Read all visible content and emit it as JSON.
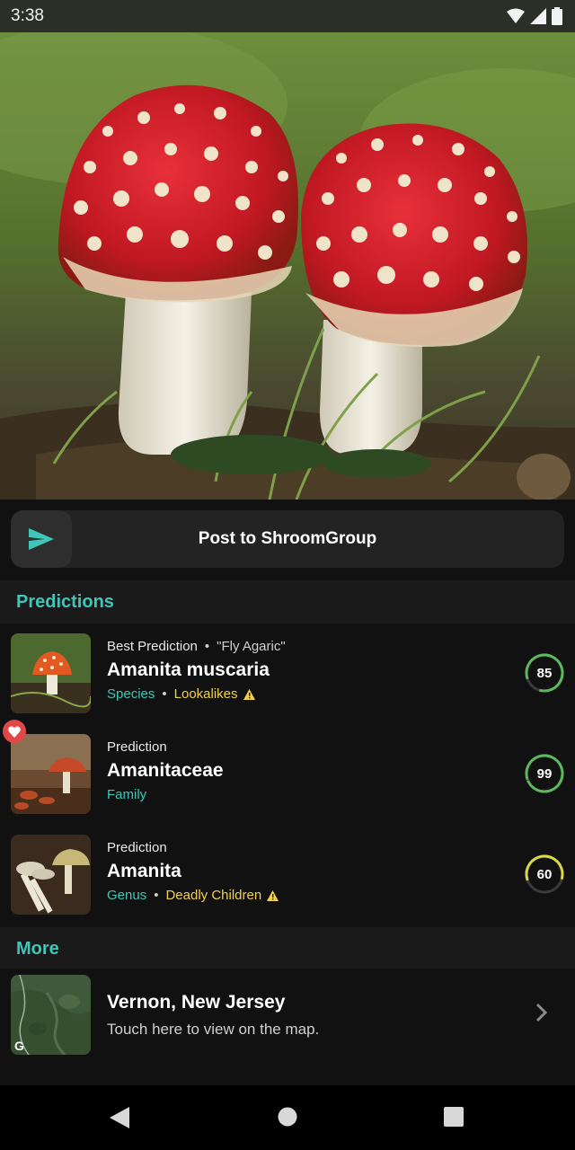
{
  "status": {
    "time": "3:38"
  },
  "post": {
    "label": "Post to ShroomGroup"
  },
  "sections": {
    "predictions": "Predictions",
    "more": "More"
  },
  "predictions": [
    {
      "kind": "Best Prediction",
      "common_name": "\"Fly Agaric\"",
      "name": "Amanita muscaria",
      "rank": "Species",
      "warning": "Lookalikes",
      "score": "85",
      "score_value": 0.85,
      "ring_color": "#5cb85c",
      "favorite": false
    },
    {
      "kind": "Prediction",
      "common_name": "",
      "name": "Amanitaceae",
      "rank": "Family",
      "warning": "",
      "score": "99",
      "score_value": 0.99,
      "ring_color": "#5cb85c",
      "favorite": true
    },
    {
      "kind": "Prediction",
      "common_name": "",
      "name": "Amanita",
      "rank": "Genus",
      "warning": "Deadly Children",
      "score": "60",
      "score_value": 0.6,
      "ring_color": "#d8d64a",
      "favorite": false
    }
  ],
  "more": {
    "title": "Vernon, New Jersey",
    "subtitle": "Touch here to view on the map.",
    "map_badge": "G"
  },
  "colors": {
    "accent": "#3ec6b8",
    "warning": "#f2d14a",
    "favorite": "#e04848"
  }
}
